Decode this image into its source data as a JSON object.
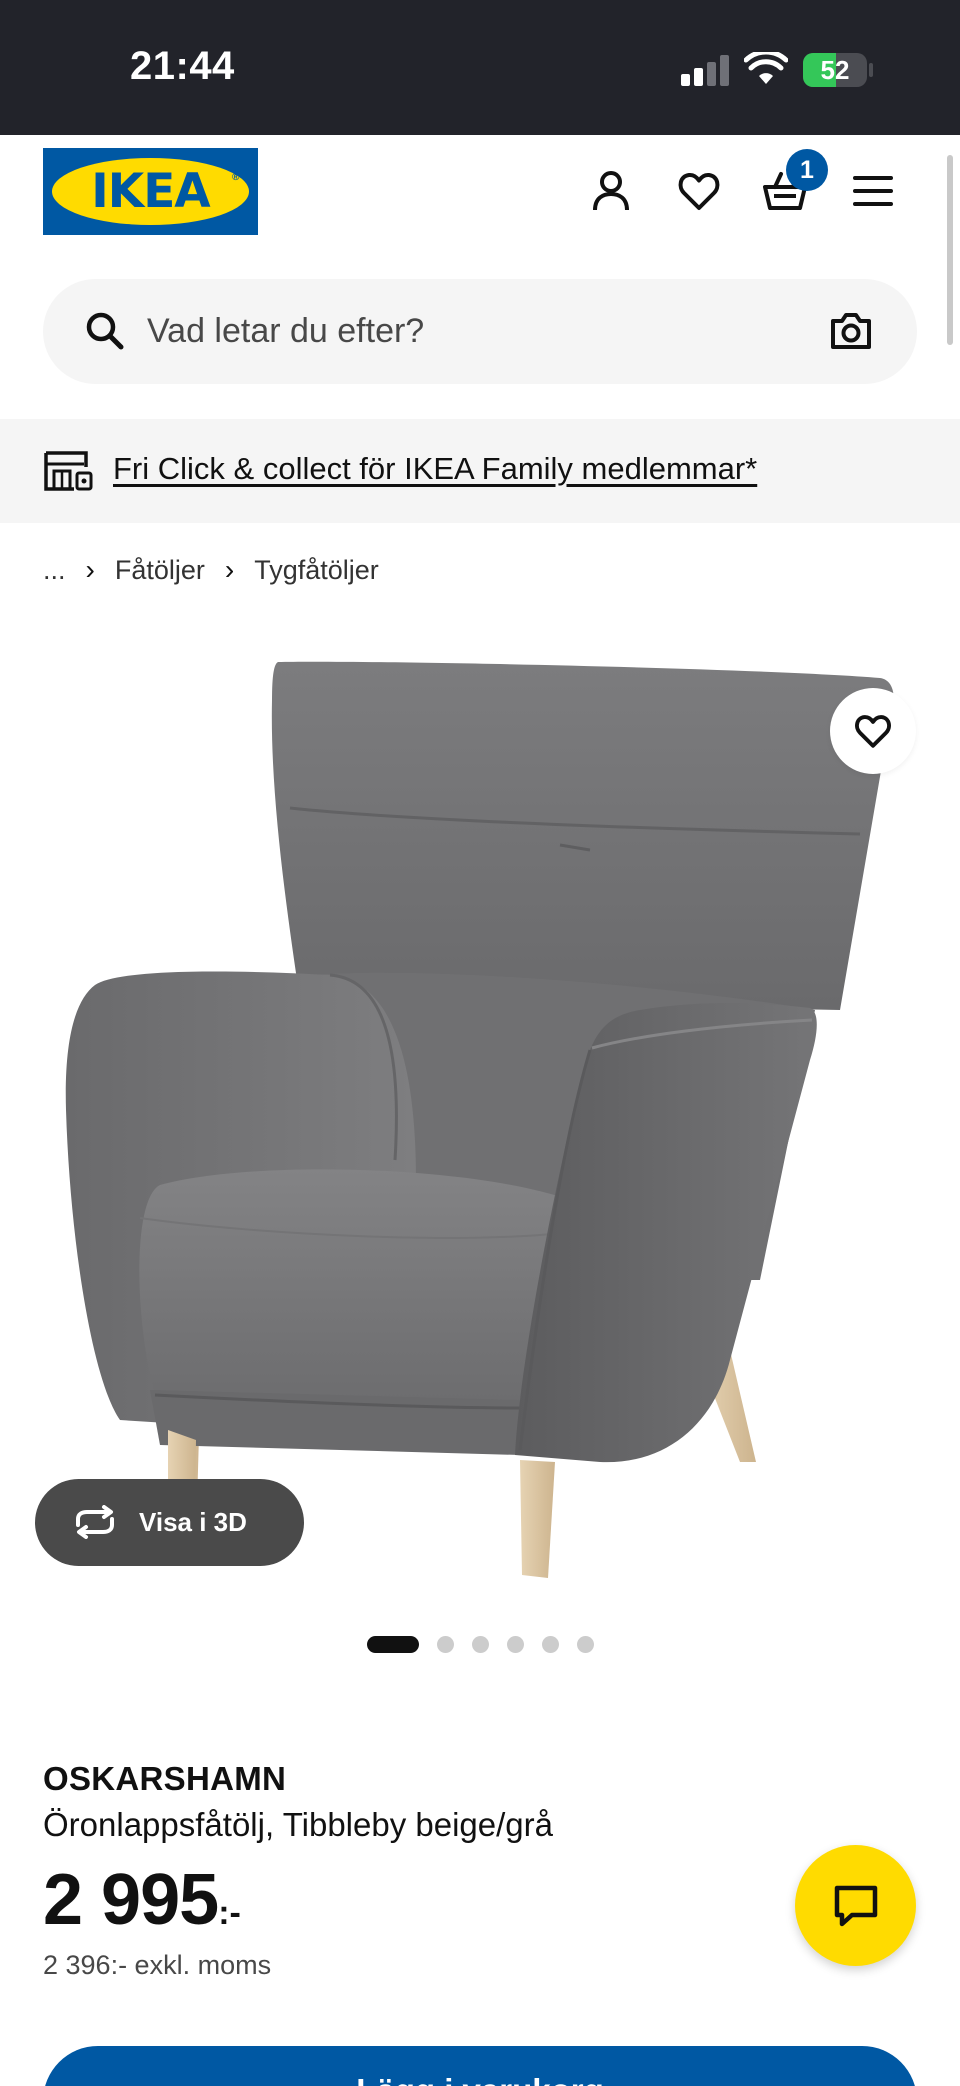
{
  "status_bar": {
    "time": "21:44",
    "battery_text": "52",
    "battery_level": 0.52,
    "battery_color": "#34c759"
  },
  "header": {
    "logo_text": "IKEA",
    "icons": [
      "profile-icon",
      "heart-icon",
      "cart-icon",
      "menu-icon"
    ],
    "cart_count": "1",
    "brand_blue": "#0058a3",
    "brand_yellow": "#ffdb00"
  },
  "search": {
    "placeholder": "Vad letar du efter?",
    "value": ""
  },
  "promo": {
    "text": "Fri Click & collect för IKEA Family medlemmar*"
  },
  "breadcrumb": {
    "items": [
      "...",
      "Fåtöljer",
      "Tygfåtöljer"
    ]
  },
  "gallery": {
    "view_3d_label": "Visa i 3D",
    "total_images": 6,
    "active_index": 0
  },
  "product": {
    "name": "OSKARSHAMN",
    "description": "Öronlappsfåtölj, Tibbleby beige/grå",
    "price": "2 995",
    "price_suffix": ":-",
    "price_ex_vat": "2 396:- exkl. moms"
  },
  "cta": {
    "label": "Lägg i varukorg"
  }
}
